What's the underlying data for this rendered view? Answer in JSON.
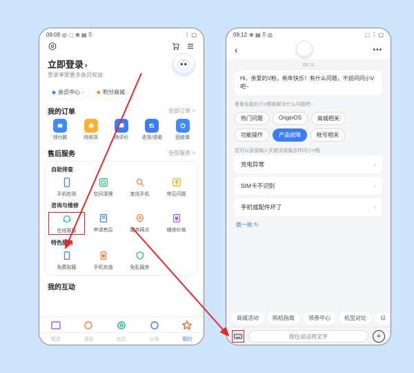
{
  "left": {
    "status": {
      "time": "09:09",
      "icons_l": "◎ ⬚ ⊕ ▤ ⠿",
      "icons_r": "⋮ ▢"
    },
    "login": {
      "title": "立即登录",
      "subtitle": "登录享受更多会员权益"
    },
    "pills": {
      "member": "会员中心",
      "points": "积分商城"
    },
    "orders": {
      "title": "我的订单",
      "more": "全部订单 >",
      "items": [
        "待付款",
        "待收货",
        "待评价",
        "退货/退款",
        "回收单"
      ]
    },
    "aftersale": {
      "title": "售后服务",
      "more": "全部服务 >",
      "self": {
        "head": "自助排查",
        "items": [
          "手机检测",
          "空间清理",
          "查找手机",
          "常见问题"
        ]
      },
      "consult": {
        "head": "咨询与维修",
        "items": [
          "在线客服",
          "申请售后",
          "服务网点",
          "维修价格"
        ]
      },
      "special": {
        "head": "特色服务",
        "items": [
          "免费贴膜",
          "手机充值",
          "免乱服务"
        ]
      }
    },
    "interact": {
      "title": "我的互动"
    },
    "tabs": [
      "精选",
      "消息",
      "社区",
      "分类",
      "我的"
    ]
  },
  "right": {
    "status": {
      "time": "09:12",
      "icons_l": "⊕ ▤ ⠿ ◎",
      "icons_r": "⬚ ⋮ ▢"
    },
    "chat_time": "09:11",
    "greeting": "Hi，亲爱的V粉，新年快乐！有什么问题，不妨问问小V吧~",
    "hint1": "看看全能的小V都能解决什么问题吧~",
    "chips": [
      "热门问题",
      "OriginOS",
      "商城相关",
      "功能操作",
      "产品故障",
      "帐号相关"
    ],
    "hint2": "您可以直接输入关键词或像这样问小V哦",
    "list": [
      "充电异常",
      "SIM卡不识别",
      "手机或配件坏了"
    ],
    "refresh": "换一批 ↻",
    "quick": [
      "商城活动",
      "购机指南",
      "领券中心",
      "机型对比",
      "以"
    ],
    "voice": "按住说话转文字"
  }
}
